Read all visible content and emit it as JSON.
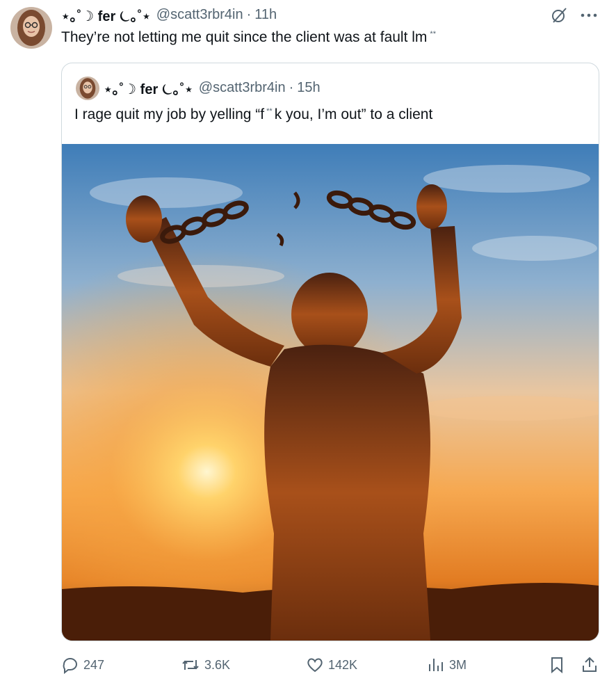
{
  "tweet": {
    "author_name": "⋆｡˚☽ fer ⏾｡˚⋆",
    "handle": "@scatt3rbr4in",
    "separator": "·",
    "time": "11h",
    "text": "They’re not letting me quit since the client was at fault lm",
    "text_suffix": "**"
  },
  "quoted": {
    "author_name": "⋆｡˚☽ fer ⏾｡˚⋆",
    "handle": "@scatt3rbr4in",
    "separator": "·",
    "time": "15h",
    "text_before": "I rage quit my job by yelling “f",
    "text_mid": "**",
    "text_after": "k you, I’m out” to a client"
  },
  "actions": {
    "replies": "247",
    "reposts": "3.6K",
    "likes": "142K",
    "views": "3M"
  },
  "icons": {
    "grok": "grok-icon",
    "more": "more-icon",
    "reply": "reply-icon",
    "repost": "repost-icon",
    "like": "heart-icon",
    "views": "views-icon",
    "bookmark": "bookmark-icon",
    "share": "share-icon"
  },
  "colors": {
    "text": "#0f1419",
    "secondary": "#536471",
    "border": "#cfd9de",
    "sky_top": "#3f7db8",
    "sun": "#ffd36b"
  }
}
